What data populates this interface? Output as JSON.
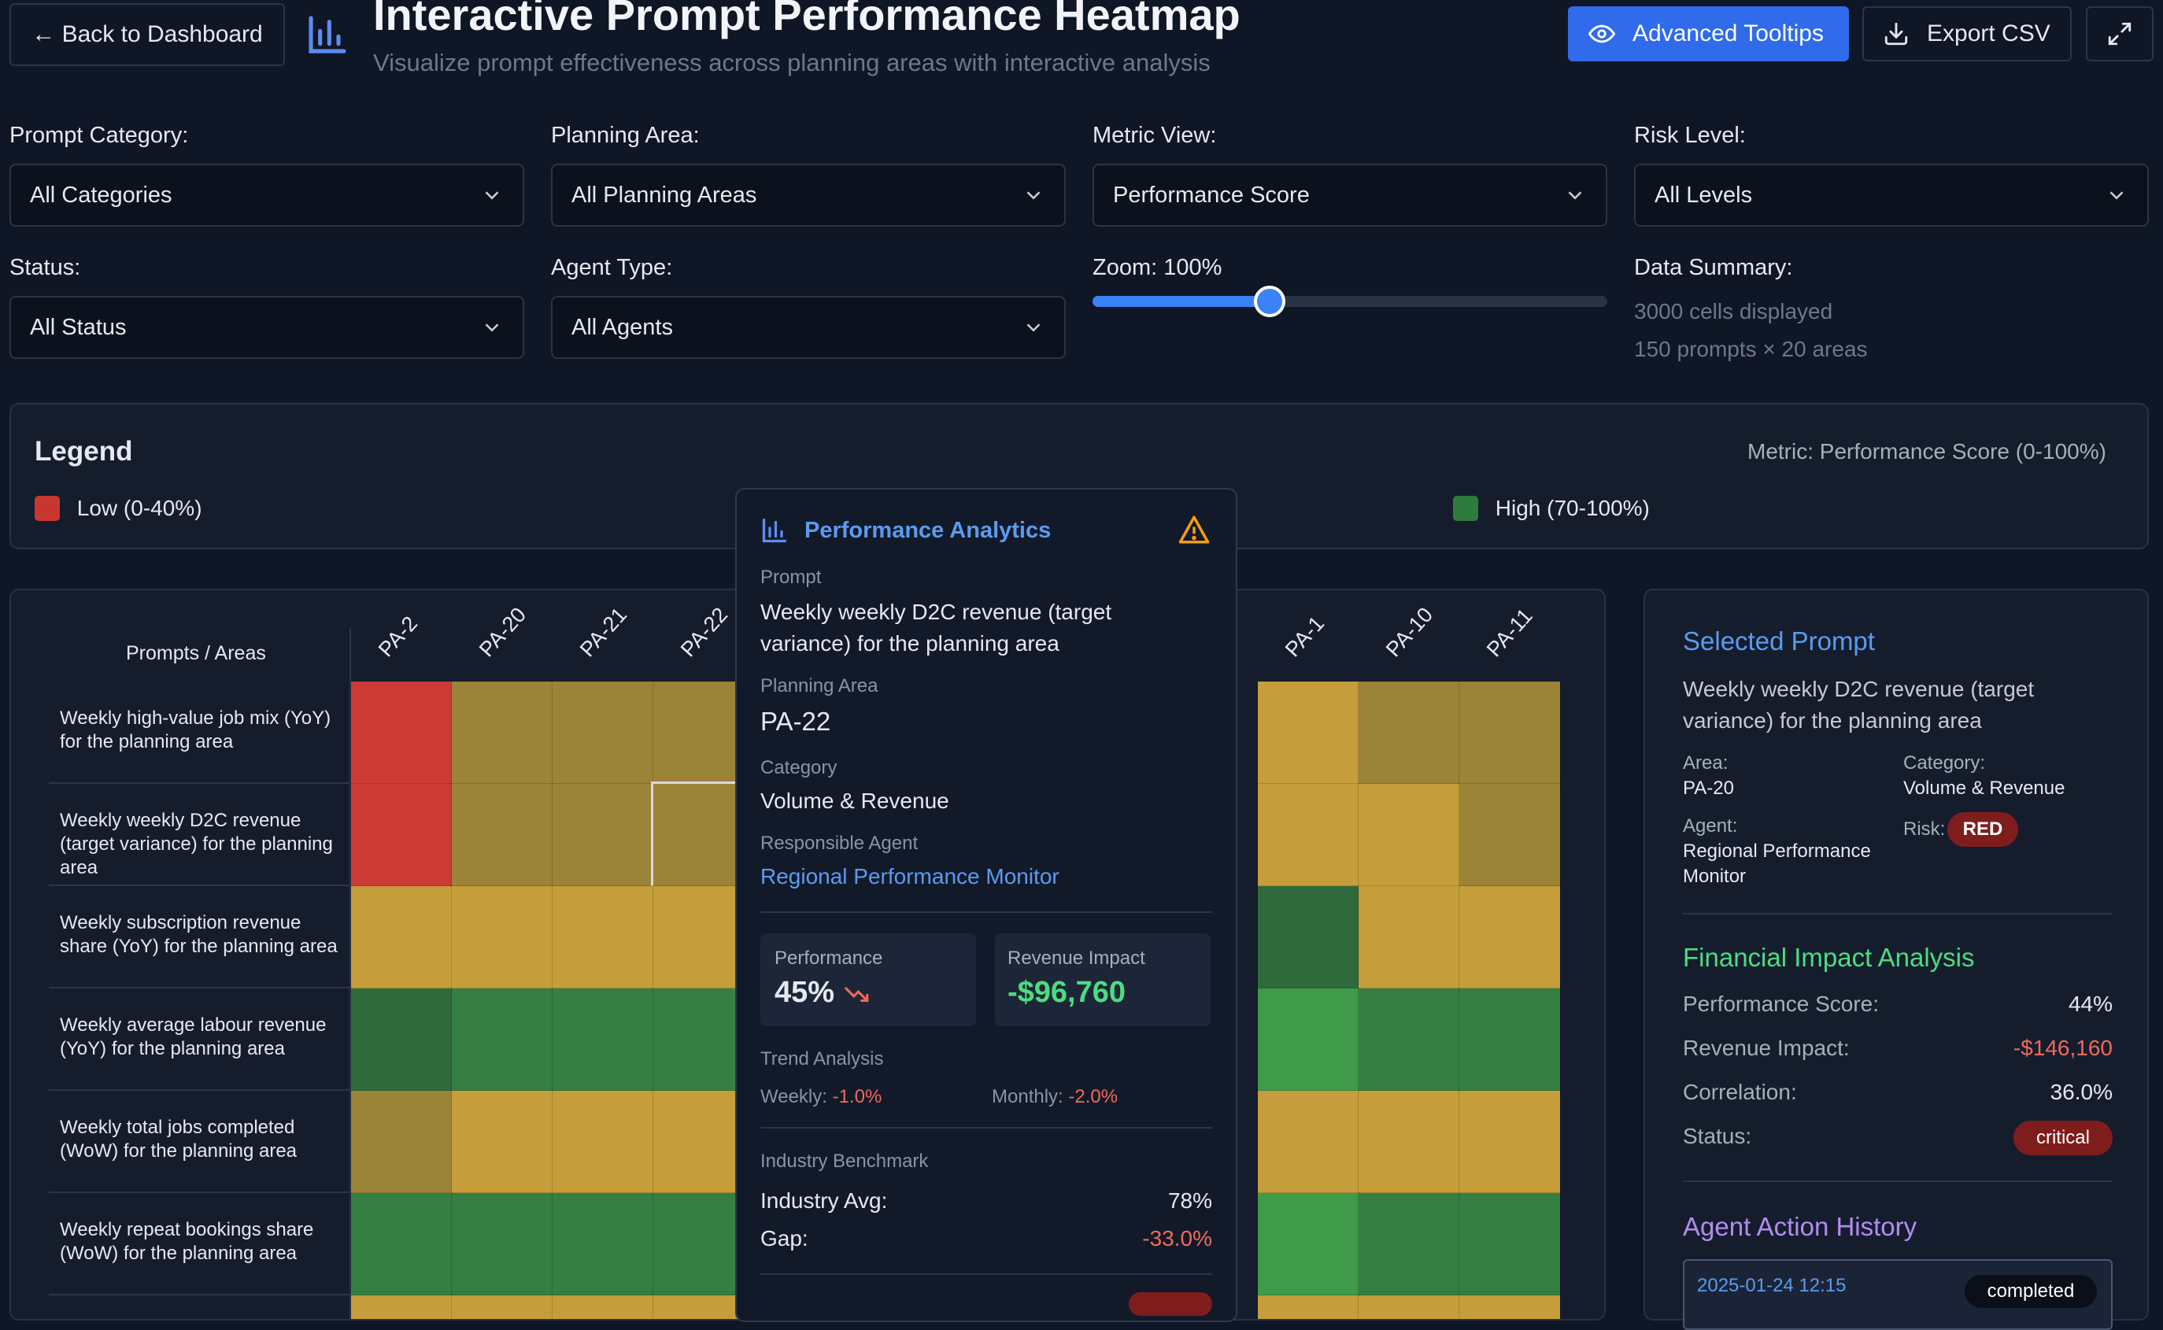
{
  "header": {
    "back_label": "← Back to Dashboard",
    "title": "Interactive Prompt Performance Heatmap",
    "subtitle": "Visualize prompt effectiveness across planning areas with interactive analysis",
    "tooltips_label": "Advanced Tooltips",
    "export_label": "Export CSV"
  },
  "filters": {
    "prompt_category": {
      "label": "Prompt Category:",
      "value": "All Categories"
    },
    "planning_area": {
      "label": "Planning Area:",
      "value": "All Planning Areas"
    },
    "metric_view": {
      "label": "Metric View:",
      "value": "Performance Score"
    },
    "risk_level": {
      "label": "Risk Level:",
      "value": "All Levels"
    },
    "status": {
      "label": "Status:",
      "value": "All Status"
    },
    "agent_type": {
      "label": "Agent Type:",
      "value": "All Agents"
    },
    "zoom": {
      "label": "Zoom: 100%",
      "value": 100
    },
    "summary": {
      "label": "Data Summary:",
      "line1": "3000 cells displayed",
      "line2": "150 prompts × 20 areas"
    }
  },
  "legend": {
    "title": "Legend",
    "metric": "Metric: Performance Score (0-100%)",
    "low": "Low (0-40%)",
    "high": "High (70-100%)",
    "low_color": "#c8372f",
    "high_color": "#2f7a3f"
  },
  "heatmap": {
    "corner": "Prompts / Areas",
    "columns": [
      "PA-2",
      "PA-20",
      "PA-21",
      "PA-22",
      "PA-1",
      "PA-10",
      "PA-11"
    ],
    "rows": [
      "Weekly high-value job mix (YoY) for the planning area",
      "Weekly weekly D2C revenue (target variance) for the planning area",
      "Weekly subscription revenue share (YoY) for the planning area",
      "Weekly average labour revenue (YoY) for the planning area",
      "Weekly total jobs completed (WoW) for the planning area",
      "Weekly repeat bookings share (WoW) for the planning area"
    ],
    "colors": {
      "red": "#cc3a34",
      "olive": "#9b8337",
      "gold": "#c59d3a",
      "dgreen": "#2f6a3c",
      "green": "#347f41",
      "lgreen": "#3f9a4a"
    }
  },
  "tooltip": {
    "title": "Performance Analytics",
    "prompt_label": "Prompt",
    "prompt": "Weekly weekly D2C revenue (target variance) for the planning area",
    "area_label": "Planning Area",
    "area": "PA-22",
    "category_label": "Category",
    "category": "Volume & Revenue",
    "agent_label": "Responsible Agent",
    "agent": "Regional Performance Monitor",
    "perf_label": "Performance",
    "perf": "45%",
    "rev_label": "Revenue Impact",
    "rev": "-$96,760",
    "trend_label": "Trend Analysis",
    "weekly_label": "Weekly:",
    "weekly": "-1.0%",
    "monthly_label": "Monthly:",
    "monthly": "-2.0%",
    "bench_label": "Industry Benchmark",
    "industry_label": "Industry Avg:",
    "industry": "78%",
    "gap_label": "Gap:",
    "gap": "-33.0%"
  },
  "selected": {
    "title": "Selected Prompt",
    "prompt": "Weekly weekly D2C revenue (target variance) for the planning area",
    "area_label": "Area:",
    "area": "PA-20",
    "category_label": "Category:",
    "category": "Volume & Revenue",
    "agent_label": "Agent:",
    "agent": "Regional Performance Monitor",
    "risk_label": "Risk:",
    "risk": "RED",
    "fin_title": "Financial Impact Analysis",
    "perf_label": "Performance Score:",
    "perf": "44%",
    "rev_label": "Revenue Impact:",
    "rev": "-$146,160",
    "corr_label": "Correlation:",
    "corr": "36.0%",
    "status_label": "Status:",
    "status": "critical",
    "history_title": "Agent Action History",
    "history_time": "2025-01-24 12:15",
    "history_status": "completed"
  }
}
